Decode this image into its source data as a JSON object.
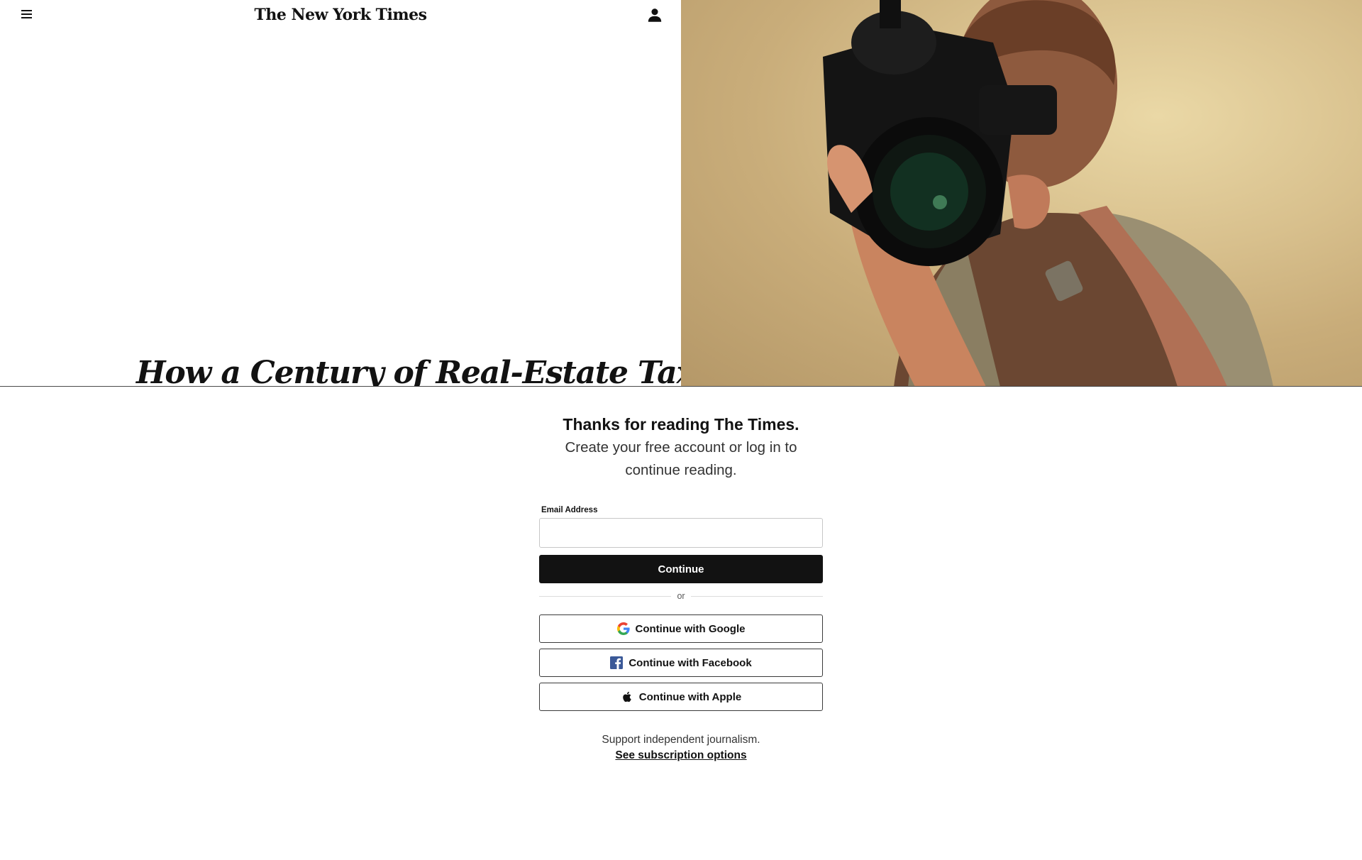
{
  "header": {
    "masthead": "The New York Times"
  },
  "article": {
    "headline_visible": "How a Century of Real-Estate Tax"
  },
  "gateway": {
    "title": "Thanks for reading The Times.",
    "subtitle": "Create your free account or log in to continue reading.",
    "email_label": "Email Address",
    "email_value": "",
    "continue_label": "Continue",
    "or_label": "or",
    "google_label": "Continue with Google",
    "facebook_label": "Continue with Facebook",
    "apple_label": "Continue with Apple",
    "support_text": "Support independent journalism.",
    "subscription_link": "See subscription options"
  },
  "colors": {
    "primary": "#121212",
    "facebook": "#3b5998",
    "border": "#c7c7c7"
  },
  "icons": {
    "menu": "hamburger-icon",
    "account": "user-icon",
    "google": "google-logo-icon",
    "facebook": "facebook-logo-icon",
    "apple": "apple-logo-icon"
  }
}
